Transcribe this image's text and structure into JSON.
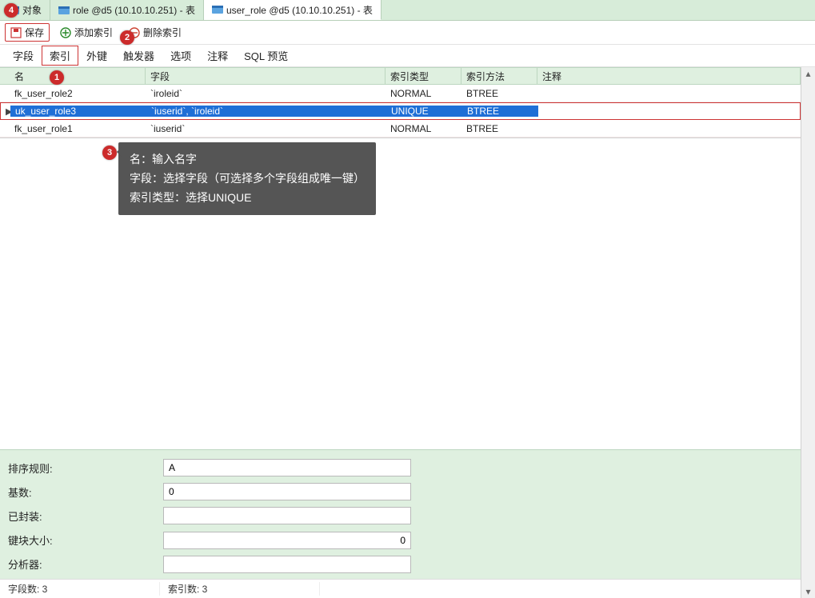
{
  "tabs": [
    {
      "label": "对象",
      "icon": "table-icon"
    },
    {
      "label": "role @d5 (10.10.10.251) - 表",
      "icon": "table-icon"
    },
    {
      "label": "user_role @d5 (10.10.10.251) - 表",
      "icon": "table-icon"
    }
  ],
  "active_tab": 2,
  "toolbar": {
    "save": "保存",
    "add_index": "添加索引",
    "del_index": "删除索引"
  },
  "subtabs": [
    "字段",
    "索引",
    "外键",
    "触发器",
    "选项",
    "注释",
    "SQL 预览"
  ],
  "active_subtab": 1,
  "grid": {
    "columns": [
      "名",
      "字段",
      "索引类型",
      "索引方法",
      "注释"
    ],
    "rows": [
      {
        "name": "fk_user_role2",
        "fields": "`iroleid`",
        "type": "NORMAL",
        "method": "BTREE",
        "comment": ""
      },
      {
        "name": "uk_user_role3",
        "fields": "`iuserid`, `iroleid`",
        "type": "UNIQUE",
        "method": "BTREE",
        "comment": ""
      },
      {
        "name": "fk_user_role1",
        "fields": "`iuserid`",
        "type": "NORMAL",
        "method": "BTREE",
        "comment": ""
      }
    ],
    "selected_row": 1
  },
  "callout": {
    "line1": "名：输入名字",
    "line2": "字段：选择字段（可选择多个字段组成唯一键）",
    "line3": "索引类型：选择UNIQUE"
  },
  "props": {
    "labels": {
      "collation": "排序规则:",
      "cardinality": "基数:",
      "packed": "已封装:",
      "block_size": "键块大小:",
      "parser": "分析器:"
    },
    "values": {
      "collation": "A",
      "cardinality": "0",
      "packed": "",
      "block_size": "0",
      "parser": ""
    }
  },
  "status": {
    "fields": "字段数: 3",
    "indexes": "索引数: 3"
  },
  "annotations": {
    "1": "名列标题",
    "2": "删除索引按钮",
    "3": "提示说明",
    "4": "对象标签页"
  },
  "colors": {
    "accent_red": "#cc2b2b",
    "select_blue": "#1f6fd6",
    "panel_green": "#dff0e0"
  }
}
